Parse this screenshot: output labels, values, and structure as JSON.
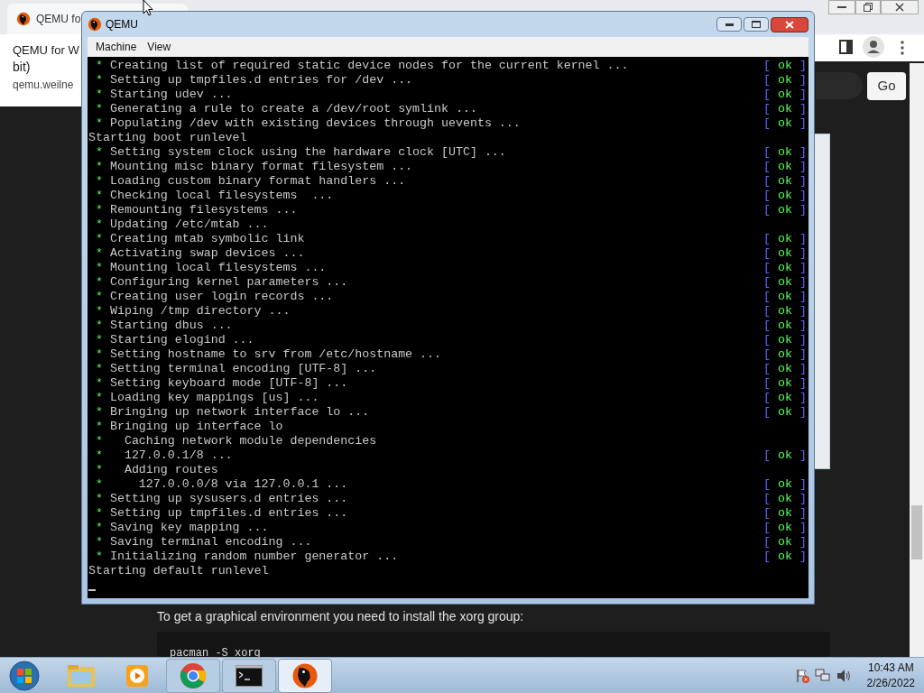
{
  "browser": {
    "tab_title": "QEMU fo",
    "popup": {
      "title": "QEMU for W",
      "title_cont": "bit)",
      "url": "qemu.weilne"
    },
    "go_button": "Go",
    "page_text": "To get a graphical environment you need to install the xorg group:",
    "code": "pacman -S xorg"
  },
  "window": {
    "title": "QEMU",
    "menu": [
      "Machine",
      "View"
    ]
  },
  "console": {
    "lines": [
      {
        "kind": "bullet",
        "text": "Creating list of required static device nodes for the current kernel ...",
        "status": "ok"
      },
      {
        "kind": "bullet",
        "text": "Setting up tmpfiles.d entries for /dev ...",
        "status": "ok"
      },
      {
        "kind": "bullet",
        "text": "Starting udev ...",
        "status": "ok"
      },
      {
        "kind": "bullet",
        "text": "Generating a rule to create a /dev/root symlink ...",
        "status": "ok"
      },
      {
        "kind": "bullet",
        "text": "Populating /dev with existing devices through uevents ...",
        "status": "ok"
      },
      {
        "kind": "plain",
        "text": "Starting boot runlevel"
      },
      {
        "kind": "bullet",
        "text": "Setting system clock using the hardware clock [UTC] ...",
        "status": "ok"
      },
      {
        "kind": "bullet",
        "text": "Mounting misc binary format filesystem ...",
        "status": "ok"
      },
      {
        "kind": "bullet",
        "text": "Loading custom binary format handlers ...",
        "status": "ok"
      },
      {
        "kind": "bullet",
        "text": "Checking local filesystems  ...",
        "status": "ok"
      },
      {
        "kind": "bullet",
        "text": "Remounting filesystems ...",
        "status": "ok"
      },
      {
        "kind": "bullet",
        "text": "Updating /etc/mtab ..."
      },
      {
        "kind": "bullet",
        "text": "Creating mtab symbolic link",
        "status": "ok"
      },
      {
        "kind": "bullet",
        "text": "Activating swap devices ...",
        "status": "ok"
      },
      {
        "kind": "bullet",
        "text": "Mounting local filesystems ...",
        "status": "ok"
      },
      {
        "kind": "bullet",
        "text": "Configuring kernel parameters ...",
        "status": "ok"
      },
      {
        "kind": "bullet",
        "text": "Creating user login records ...",
        "status": "ok"
      },
      {
        "kind": "bullet",
        "text": "Wiping /tmp directory ...",
        "status": "ok"
      },
      {
        "kind": "bullet",
        "text": "Starting dbus ...",
        "status": "ok"
      },
      {
        "kind": "bullet",
        "text": "Starting elogind ...",
        "status": "ok"
      },
      {
        "kind": "bullet",
        "text": "Setting hostname to srv from /etc/hostname ...",
        "status": "ok"
      },
      {
        "kind": "bullet",
        "text": "Setting terminal encoding [UTF-8] ...",
        "status": "ok"
      },
      {
        "kind": "bullet",
        "text": "Setting keyboard mode [UTF-8] ...",
        "status": "ok"
      },
      {
        "kind": "bullet",
        "text": "Loading key mappings [us] ...",
        "status": "ok"
      },
      {
        "kind": "bullet",
        "text": "Bringing up network interface lo ...",
        "status": "ok"
      },
      {
        "kind": "bullet",
        "text": "Bringing up interface lo"
      },
      {
        "kind": "bullet",
        "text": "  Caching network module dependencies"
      },
      {
        "kind": "bullet",
        "text": "  127.0.0.1/8 ...",
        "status": "ok"
      },
      {
        "kind": "bullet",
        "text": "  Adding routes"
      },
      {
        "kind": "bullet",
        "text": "    127.0.0.0/8 via 127.0.0.1 ...",
        "status": "ok"
      },
      {
        "kind": "bullet",
        "text": "Setting up sysusers.d entries ...",
        "status": "ok"
      },
      {
        "kind": "bullet",
        "text": "Setting up tmpfiles.d entries ...",
        "status": "ok"
      },
      {
        "kind": "bullet",
        "text": "Saving key mapping ...",
        "status": "ok"
      },
      {
        "kind": "bullet",
        "text": "Saving terminal encoding ...",
        "status": "ok"
      },
      {
        "kind": "bullet",
        "text": "Initializing random number generator ...",
        "status": "ok"
      },
      {
        "kind": "plain",
        "text": "Starting default runlevel"
      }
    ],
    "bullet": "*",
    "ok_open": "[",
    "ok_close": "]"
  },
  "taskbar": {
    "items": [
      {
        "kind": "folder",
        "selected": false
      },
      {
        "kind": "media",
        "selected": false
      },
      {
        "kind": "chrome",
        "selected": false
      },
      {
        "kind": "terminal",
        "selected": false
      },
      {
        "kind": "qemu",
        "selected": true
      }
    ],
    "time": "10:43 AM",
    "date": "2/26/2022"
  }
}
